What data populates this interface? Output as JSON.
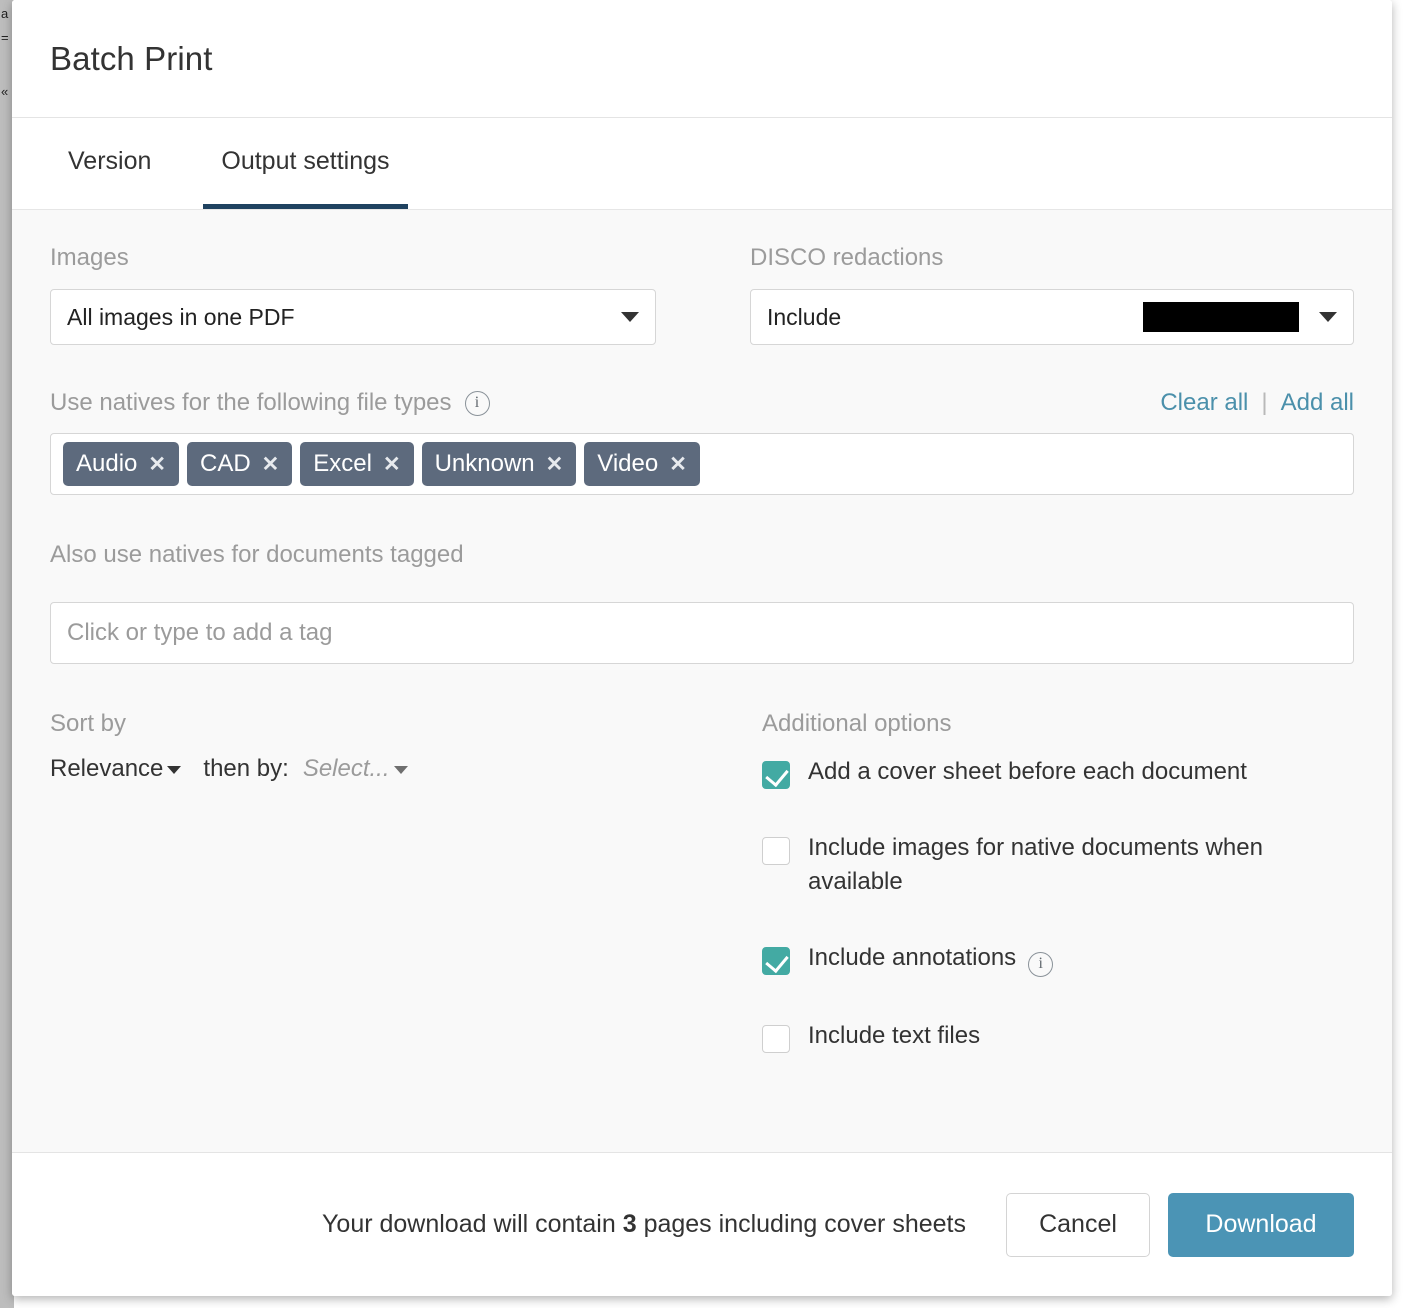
{
  "background": {
    "fragments": [
      "a",
      "=",
      "«",
      "—",
      "▬",
      "—"
    ]
  },
  "modal": {
    "title": "Batch Print",
    "tabs": [
      {
        "label": "Version",
        "active": false
      },
      {
        "label": "Output settings",
        "active": true
      }
    ],
    "active_tab_underline_color": "#1f4260"
  },
  "output_settings": {
    "images": {
      "label": "Images",
      "selected": "All images in one PDF",
      "caret_icon": "chevron-down-icon"
    },
    "disco_redactions": {
      "label": "DISCO redactions",
      "selected": "Include",
      "swatch_color": "#000000",
      "swatch_icon": "redaction-bar-swatch",
      "caret_icon": "chevron-down-icon"
    },
    "natives_file_types": {
      "label": "Use natives for the following file types",
      "info_icon": "info-icon",
      "clear_all_label": "Clear all",
      "separator": "|",
      "add_all_label": "Add all",
      "link_color": "#4b90ab",
      "chip_color": "#5d6a7d",
      "chips": [
        "Audio",
        "CAD",
        "Excel",
        "Unknown",
        "Video"
      ],
      "chip_remove_icon": "✕"
    },
    "tagged_documents": {
      "label": "Also use natives for documents tagged",
      "placeholder": "Click or type to add a tag",
      "value": ""
    },
    "sort_by": {
      "label": "Sort by",
      "primary": "Relevance",
      "then_by_label": "then by:",
      "secondary_placeholder": "Select..."
    },
    "additional_options": {
      "label": "Additional options",
      "checked_color": "#43aaa3",
      "items": [
        {
          "label": "Add a cover sheet before each document",
          "checked": true,
          "info": false
        },
        {
          "label": "Include images for native documents when available",
          "checked": false,
          "info": false
        },
        {
          "label": "Include annotations",
          "checked": true,
          "info": true
        },
        {
          "label": "Include text files",
          "checked": false,
          "info": false
        }
      ]
    }
  },
  "footer": {
    "note_prefix": "Your download will contain",
    "note_count": "3",
    "note_suffix": "pages including cover sheets",
    "cancel_label": "Cancel",
    "download_label": "Download",
    "download_color": "#4b94b5"
  }
}
